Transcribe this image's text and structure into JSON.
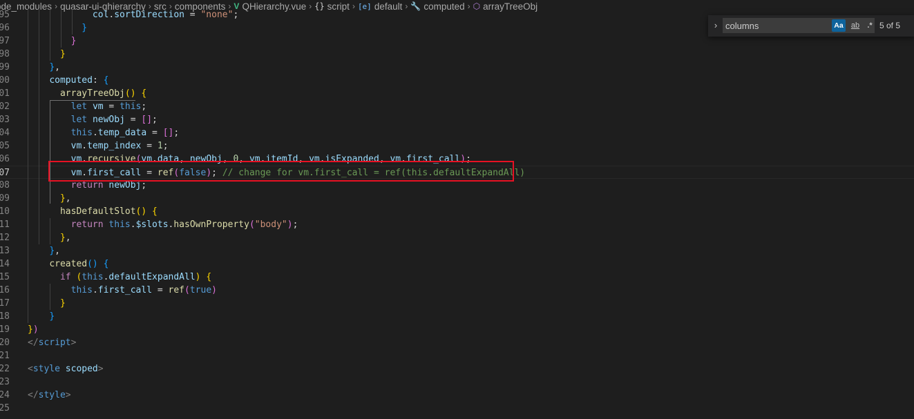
{
  "breadcrumb": {
    "items": [
      {
        "label": "ode_modules",
        "icon": null
      },
      {
        "label": "quasar-ui-qhierarchy",
        "icon": null
      },
      {
        "label": "src",
        "icon": null
      },
      {
        "label": "components",
        "icon": null
      },
      {
        "label": "QHierarchy.vue",
        "icon": "vue-icon",
        "glyph": "V"
      },
      {
        "label": "script",
        "icon": "braces-icon",
        "glyph": "{}"
      },
      {
        "label": "default",
        "icon": "module-icon",
        "glyph": "[e]"
      },
      {
        "label": "computed",
        "icon": "wrench-icon",
        "glyph": "🔧"
      },
      {
        "label": "arrayTreeObj",
        "icon": "cube-icon",
        "glyph": "⬡"
      }
    ],
    "separator": "›"
  },
  "editor": {
    "active_line": "07",
    "lines": [
      {
        "n": "95",
        "tokens": [
          [
            "            ",
            ""
          ],
          [
            "col",
            "vr"
          ],
          [
            ".",
            ""
          ],
          [
            "sortDirection",
            "vr"
          ],
          [
            " = ",
            ""
          ],
          [
            "\"none\"",
            "str"
          ],
          [
            ";",
            ""
          ]
        ]
      },
      {
        "n": "96",
        "tokens": [
          [
            "          ",
            ""
          ],
          [
            "}",
            "b3"
          ]
        ]
      },
      {
        "n": "97",
        "tokens": [
          [
            "        ",
            ""
          ],
          [
            "}",
            "b2"
          ]
        ]
      },
      {
        "n": "98",
        "tokens": [
          [
            "      ",
            ""
          ],
          [
            "}",
            "b1"
          ]
        ]
      },
      {
        "n": "99",
        "tokens": [
          [
            "    ",
            ""
          ],
          [
            "}",
            "b3"
          ],
          [
            ",",
            ""
          ]
        ]
      },
      {
        "n": "00",
        "tokens": [
          [
            "    ",
            ""
          ],
          [
            "computed",
            "vr"
          ],
          [
            ": ",
            ""
          ],
          [
            "{",
            "b3"
          ]
        ]
      },
      {
        "n": "01",
        "tokens": [
          [
            "      ",
            ""
          ],
          [
            "arrayTreeObj",
            "fn"
          ],
          [
            "()",
            "b1"
          ],
          [
            " ",
            ""
          ],
          [
            "{",
            "b1"
          ]
        ]
      },
      {
        "n": "02",
        "tokens": [
          [
            "        ",
            ""
          ],
          [
            "let",
            "kw"
          ],
          [
            " ",
            ""
          ],
          [
            "vm",
            "vr"
          ],
          [
            " = ",
            ""
          ],
          [
            "this",
            "kw"
          ],
          [
            ";",
            ""
          ]
        ]
      },
      {
        "n": "03",
        "tokens": [
          [
            "        ",
            ""
          ],
          [
            "let",
            "kw"
          ],
          [
            " ",
            ""
          ],
          [
            "newObj",
            "vr"
          ],
          [
            " = ",
            ""
          ],
          [
            "[]",
            "b2"
          ],
          [
            ";",
            ""
          ]
        ]
      },
      {
        "n": "04",
        "tokens": [
          [
            "        ",
            ""
          ],
          [
            "this",
            "kw"
          ],
          [
            ".",
            ""
          ],
          [
            "temp_data",
            "vr"
          ],
          [
            " = ",
            ""
          ],
          [
            "[]",
            "b2"
          ],
          [
            ";",
            ""
          ]
        ]
      },
      {
        "n": "05",
        "tokens": [
          [
            "        ",
            ""
          ],
          [
            "vm",
            "vr"
          ],
          [
            ".",
            ""
          ],
          [
            "temp_index",
            "vr"
          ],
          [
            " = ",
            ""
          ],
          [
            "1",
            "num"
          ],
          [
            ";",
            ""
          ]
        ]
      },
      {
        "n": "06",
        "tokens": [
          [
            "        ",
            ""
          ],
          [
            "vm",
            "vr"
          ],
          [
            ".",
            ""
          ],
          [
            "recursive",
            "fn"
          ],
          [
            "(",
            "b2"
          ],
          [
            "vm",
            "vr"
          ],
          [
            ".",
            ""
          ],
          [
            "data",
            "vr"
          ],
          [
            ", ",
            ""
          ],
          [
            "newObj",
            "vr"
          ],
          [
            ", ",
            ""
          ],
          [
            "0",
            "num"
          ],
          [
            ", ",
            ""
          ],
          [
            "vm",
            "vr"
          ],
          [
            ".",
            ""
          ],
          [
            "itemId",
            "vr"
          ],
          [
            ", ",
            ""
          ],
          [
            "vm",
            "vr"
          ],
          [
            ".",
            ""
          ],
          [
            "isExpanded",
            "vr"
          ],
          [
            ", ",
            ""
          ],
          [
            "vm",
            "vr"
          ],
          [
            ".",
            ""
          ],
          [
            "first_call",
            "vr"
          ],
          [
            ")",
            "b2"
          ],
          [
            ";",
            ""
          ]
        ]
      },
      {
        "n": "07",
        "tokens": [
          [
            "        ",
            ""
          ],
          [
            "vm",
            "vr"
          ],
          [
            ".",
            ""
          ],
          [
            "first_call",
            "vr"
          ],
          [
            " = ",
            ""
          ],
          [
            "ref",
            "fn"
          ],
          [
            "(",
            "b2"
          ],
          [
            "false",
            "kw"
          ],
          [
            ")",
            "b2"
          ],
          [
            "; ",
            ""
          ],
          [
            "// change for vm.first_call = ref(this.defaultExpandAll)",
            "cm"
          ]
        ]
      },
      {
        "n": "08",
        "tokens": [
          [
            "        ",
            ""
          ],
          [
            "return",
            "ctl"
          ],
          [
            " ",
            ""
          ],
          [
            "newObj",
            "vr"
          ],
          [
            ";",
            ""
          ]
        ]
      },
      {
        "n": "09",
        "tokens": [
          [
            "      ",
            ""
          ],
          [
            "}",
            "b1"
          ],
          [
            ",",
            ""
          ]
        ]
      },
      {
        "n": "10",
        "tokens": [
          [
            "      ",
            ""
          ],
          [
            "hasDefaultSlot",
            "fn"
          ],
          [
            "()",
            "b1"
          ],
          [
            " ",
            ""
          ],
          [
            "{",
            "b1"
          ]
        ]
      },
      {
        "n": "11",
        "tokens": [
          [
            "        ",
            ""
          ],
          [
            "return",
            "ctl"
          ],
          [
            " ",
            ""
          ],
          [
            "this",
            "kw"
          ],
          [
            ".",
            ""
          ],
          [
            "$slots",
            "vr"
          ],
          [
            ".",
            ""
          ],
          [
            "hasOwnProperty",
            "fn"
          ],
          [
            "(",
            "b2"
          ],
          [
            "\"body\"",
            "str"
          ],
          [
            ")",
            "b2"
          ],
          [
            ";",
            ""
          ]
        ]
      },
      {
        "n": "12",
        "tokens": [
          [
            "      ",
            ""
          ],
          [
            "}",
            "b1"
          ],
          [
            ",",
            ""
          ]
        ]
      },
      {
        "n": "13",
        "tokens": [
          [
            "    ",
            ""
          ],
          [
            "}",
            "b3"
          ],
          [
            ",",
            ""
          ]
        ]
      },
      {
        "n": "14",
        "tokens": [
          [
            "    ",
            ""
          ],
          [
            "created",
            "fn"
          ],
          [
            "()",
            "b3"
          ],
          [
            " ",
            ""
          ],
          [
            "{",
            "b3"
          ]
        ]
      },
      {
        "n": "15",
        "tokens": [
          [
            "      ",
            ""
          ],
          [
            "if",
            "ctl"
          ],
          [
            " ",
            ""
          ],
          [
            "(",
            "b1"
          ],
          [
            "this",
            "kw"
          ],
          [
            ".",
            ""
          ],
          [
            "defaultExpandAll",
            "vr"
          ],
          [
            ")",
            "b1"
          ],
          [
            " ",
            ""
          ],
          [
            "{",
            "b1"
          ]
        ]
      },
      {
        "n": "16",
        "tokens": [
          [
            "        ",
            ""
          ],
          [
            "this",
            "kw"
          ],
          [
            ".",
            ""
          ],
          [
            "first_call",
            "vr"
          ],
          [
            " = ",
            ""
          ],
          [
            "ref",
            "fn"
          ],
          [
            "(",
            "b2"
          ],
          [
            "true",
            "kw"
          ],
          [
            ")",
            "b2"
          ]
        ]
      },
      {
        "n": "17",
        "tokens": [
          [
            "      ",
            ""
          ],
          [
            "}",
            "b1"
          ]
        ]
      },
      {
        "n": "18",
        "tokens": [
          [
            "    ",
            ""
          ],
          [
            "}",
            "b3"
          ]
        ]
      },
      {
        "n": "19",
        "tokens": [
          [
            "",
            ""
          ],
          [
            "}",
            "b1"
          ],
          [
            ")",
            "b2"
          ]
        ]
      },
      {
        "n": "20",
        "tokens": [
          [
            "</",
            "punc"
          ],
          [
            "script",
            "tag"
          ],
          [
            ">",
            "punc"
          ]
        ]
      },
      {
        "n": "21",
        "tokens": []
      },
      {
        "n": "22",
        "tokens": [
          [
            "<",
            "punc"
          ],
          [
            "style",
            "tag"
          ],
          [
            " ",
            ""
          ],
          [
            "scoped",
            "attr"
          ],
          [
            ">",
            "punc"
          ]
        ]
      },
      {
        "n": "23",
        "tokens": []
      },
      {
        "n": "24",
        "tokens": [
          [
            "</",
            "punc"
          ],
          [
            "style",
            "tag"
          ],
          [
            ">",
            "punc"
          ]
        ]
      },
      {
        "n": "25",
        "tokens": []
      }
    ]
  },
  "find_widget": {
    "toggle_glyph": "›",
    "query": "columns",
    "match_case_label": "Aa",
    "whole_word_label": "ab",
    "regex_label": ".*",
    "match_count": "5 of 5"
  },
  "colors": {
    "background": "#1e1e1e",
    "highlight_box": "#e81123",
    "find_option_active": "#0e639c"
  }
}
